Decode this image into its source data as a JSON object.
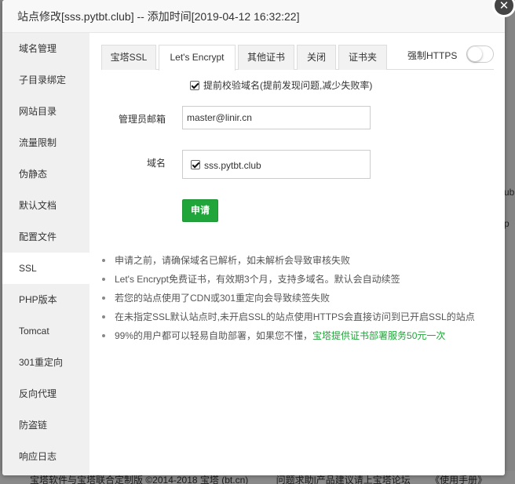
{
  "dialog": {
    "title": "站点修改[sss.pytbt.club] -- 添加时间[2019-04-12 16:32:22]",
    "close_icon": "close-icon"
  },
  "sidebar": {
    "items": [
      {
        "label": "域名管理"
      },
      {
        "label": "子目录绑定"
      },
      {
        "label": "网站目录"
      },
      {
        "label": "流量限制"
      },
      {
        "label": "伪静态"
      },
      {
        "label": "默认文档"
      },
      {
        "label": "配置文件"
      },
      {
        "label": "SSL",
        "active": true
      },
      {
        "label": "PHP版本"
      },
      {
        "label": "Tomcat"
      },
      {
        "label": "301重定向"
      },
      {
        "label": "反向代理"
      },
      {
        "label": "防盗链"
      },
      {
        "label": "响应日志"
      }
    ]
  },
  "tabs": [
    {
      "label": "宝塔SSL"
    },
    {
      "label": "Let's Encrypt",
      "active": true
    },
    {
      "label": "其他证书"
    },
    {
      "label": "关闭"
    },
    {
      "label": "证书夹"
    }
  ],
  "force_https": {
    "label": "强制HTTPS",
    "enabled": false
  },
  "form": {
    "precheck_label": "提前校验域名(提前发现问题,减少失败率)",
    "precheck_checked": true,
    "email_label": "管理员邮箱",
    "email_value": "master@linir.cn",
    "domain_label": "域名",
    "domains": [
      {
        "name": "sss.pytbt.club",
        "checked": true
      }
    ],
    "apply_label": "申请"
  },
  "notes": {
    "items": [
      "申请之前，请确保域名已解析，如未解析会导致审核失败",
      "Let's Encrypt免费证书，有效期3个月，支持多域名。默认会自动续签",
      "若您的站点使用了CDN或301重定向会导致续签失败",
      "在未指定SSL默认站点时,未开启SSL的站点使用HTTPS会直接访问到已开启SSL的站点"
    ],
    "last_prefix": "99%的用户都可以轻易自助部署，如果您不懂，",
    "last_link": "宝塔提供证书部署服务50元一次"
  },
  "background": {
    "frag1": "ub",
    "frag2": "p",
    "footer_copyright": "宝塔软件与宝塔联合定制版 ©2014-2018 宝塔 (bt.cn)",
    "footer_link1": "问题求助|产品建议请上宝塔论坛",
    "footer_link2": "《使用手册》"
  },
  "colors": {
    "accent": "#20a53a",
    "sidebar_bg": "#f0f0f0"
  }
}
